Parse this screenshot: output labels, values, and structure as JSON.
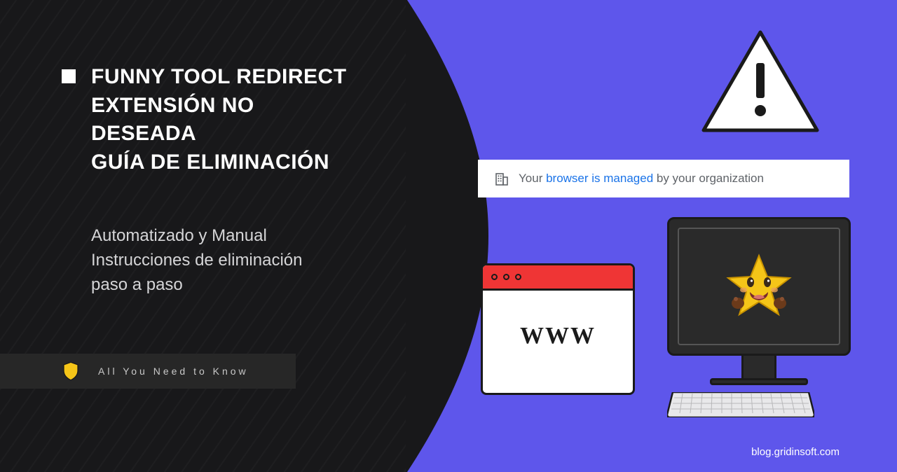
{
  "left": {
    "title_line1": "FUNNY TOOL REDIRECT",
    "title_line2": "EXTENSIÓN NO DESEADA",
    "title_line3": "GUÍA DE ELIMINACIÓN",
    "subtitle_line1": "Automatizado y Manual",
    "subtitle_line2": "Instrucciones de eliminación",
    "subtitle_line3": "paso a paso",
    "badge": "All You Need to Know"
  },
  "right": {
    "org_prefix": "Your ",
    "org_link": "browser is managed",
    "org_suffix": " by your organization",
    "www": "WWW",
    "site_url": "blog.gridinsoft.com"
  },
  "icons": {
    "shield": "shield-icon",
    "building": "building-icon",
    "warning": "warning-triangle-icon",
    "star_face": "star-face-icon"
  },
  "colors": {
    "dark": "#18181a",
    "purple": "#5e56eb",
    "red": "#ef3535",
    "link": "#1a73e8"
  }
}
